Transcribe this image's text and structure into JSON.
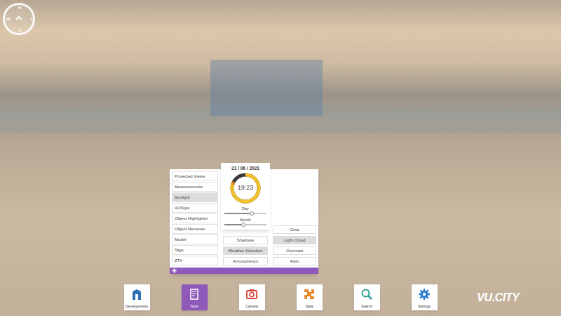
{
  "compass": {
    "letters": [
      "N",
      "E",
      "S",
      "W"
    ]
  },
  "tools_menu": {
    "items": [
      {
        "label": "Protected Views",
        "selected": false
      },
      {
        "label": "Measurements",
        "selected": false
      },
      {
        "label": "Sunlight",
        "selected": true
      },
      {
        "label": "VUStyle",
        "selected": false
      },
      {
        "label": "Object Highlighter",
        "selected": false
      },
      {
        "label": "Object Remover",
        "selected": false
      },
      {
        "label": "Model",
        "selected": false
      },
      {
        "label": "Tags",
        "selected": false
      },
      {
        "label": "ZTV",
        "selected": false
      }
    ]
  },
  "sunlight": {
    "date": "21 / 06 / 2021",
    "time": "19:23",
    "level": 0.81,
    "sliders": [
      {
        "label": "Day",
        "level": 0.65
      },
      {
        "label": "Month",
        "level": 0.45
      }
    ]
  },
  "options": [
    {
      "label": "Shadows",
      "selected": false
    },
    {
      "label": "Weather Selection",
      "selected": true
    },
    {
      "label": "Atmospherics",
      "selected": false
    }
  ],
  "weather": [
    {
      "label": "Clear",
      "selected": false
    },
    {
      "label": "Light Cloud",
      "selected": true
    },
    {
      "label": "Overcast",
      "selected": false
    },
    {
      "label": "Rain",
      "selected": false
    }
  ],
  "dock": [
    {
      "label": "Developments",
      "selected": false,
      "color": "#2f6fb5"
    },
    {
      "label": "Tools",
      "selected": true,
      "color": "#ffffff"
    },
    {
      "label": "Camera",
      "selected": false,
      "color": "#d9453b"
    },
    {
      "label": "Data",
      "selected": false,
      "color": "#e8862a"
    },
    {
      "label": "Search",
      "selected": false,
      "color": "#2a9d8f"
    },
    {
      "label": "Settings",
      "selected": false,
      "color": "#2f7fd0"
    }
  ],
  "logo": {
    "text": "VU.CITY"
  }
}
